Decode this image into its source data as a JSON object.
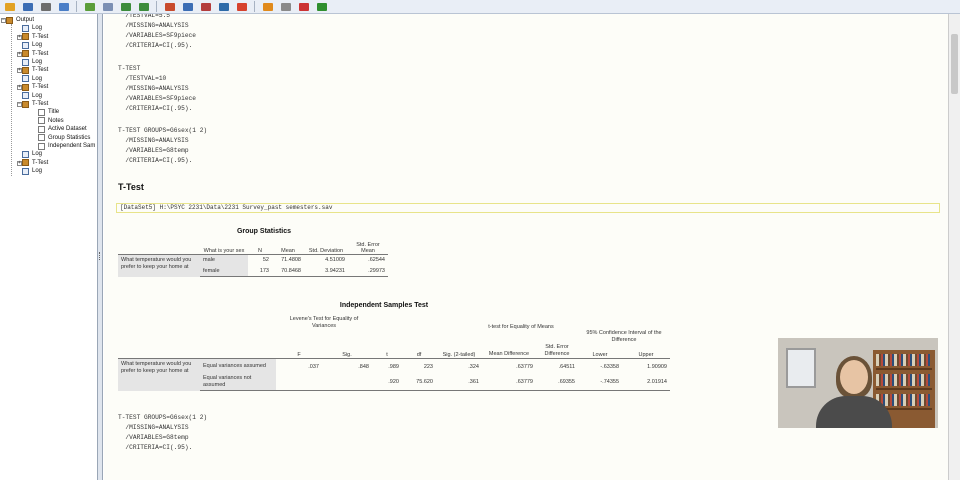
{
  "toolbar": {
    "buttons": [
      "open-icon",
      "save-icon",
      "print-icon",
      "print-preview-icon",
      "export-icon",
      "recall-dialog-icon",
      "undo-icon",
      "redo-icon",
      "goto-data-icon",
      "goto-case-icon",
      "variables-icon",
      "chart-icon",
      "insert-heading-icon",
      "insert-title-icon",
      "insert-text-icon",
      "designate-window-icon",
      "show-all-icon"
    ],
    "colors": [
      "#e2a224",
      "#3b6db4",
      "#6d6d6d",
      "#4a7ec7",
      "#5a9d3a",
      "#7b8fb3",
      "#3c8c3c",
      "#3c8c3c",
      "#c84b2d",
      "#3b6db4",
      "#b33c3c",
      "#2d6aa8",
      "#d6412d",
      "#e08a1c",
      "#8a8a8a",
      "#cc3333",
      "#2f8f2f"
    ]
  },
  "outline": {
    "items": [
      {
        "label": "Output",
        "level": 0,
        "icon": "output-book-icon"
      },
      {
        "label": "Log",
        "level": 1,
        "icon": "log-icon"
      },
      {
        "label": "T-Test",
        "level": 1,
        "icon": "book-icon"
      },
      {
        "label": "Log",
        "level": 1,
        "icon": "log-icon"
      },
      {
        "label": "T-Test",
        "level": 1,
        "icon": "book-icon"
      },
      {
        "label": "Log",
        "level": 1,
        "icon": "log-icon"
      },
      {
        "label": "T-Test",
        "level": 1,
        "icon": "book-icon"
      },
      {
        "label": "Log",
        "level": 1,
        "icon": "log-icon"
      },
      {
        "label": "T-Test",
        "level": 1,
        "icon": "book-icon"
      },
      {
        "label": "Log",
        "level": 1,
        "icon": "log-icon"
      },
      {
        "label": "T-Test",
        "level": 1,
        "icon": "book-icon"
      },
      {
        "label": "Title",
        "level": 2,
        "icon": "page-icon"
      },
      {
        "label": "Notes",
        "level": 2,
        "icon": "page-icon"
      },
      {
        "label": "Active Dataset",
        "level": 2,
        "icon": "page-icon"
      },
      {
        "label": "Group Statistics",
        "level": 2,
        "icon": "page-icon"
      },
      {
        "label": "Independent Sam",
        "level": 2,
        "icon": "page-icon"
      },
      {
        "label": "Log",
        "level": 1,
        "icon": "log-icon"
      },
      {
        "label": "T-Test",
        "level": 1,
        "icon": "book-icon"
      },
      {
        "label": "Log",
        "level": 1,
        "icon": "log-icon"
      }
    ]
  },
  "syntax": {
    "block1": "  /TESTVAL=5.5\n  /MISSING=ANALYSIS\n  /VARIABLES=SF9piece\n  /CRITERIA=CI(.95).",
    "block2": "T-TEST\n  /TESTVAL=10\n  /MISSING=ANALYSIS\n  /VARIABLES=SF9piece\n  /CRITERIA=CI(.95).",
    "block3": "T-TEST GROUPS=G6sex(1 2)\n  /MISSING=ANALYSIS\n  /VARIABLES=G8temp\n  /CRITERIA=CI(.95).",
    "block4": "T-TEST GROUPS=G6sex(1 2)\n  /MISSING=ANALYSIS\n  /VARIABLES=G8temp\n  /CRITERIA=CI(.95)."
  },
  "section_title": "T-Test",
  "dataset_line": "[DataSet5] H:\\PSYC 2231\\Data\\2231 Survey_past semesters.sav",
  "group_stats": {
    "title": "Group Statistics",
    "headers": [
      "What is your sex",
      "N",
      "Mean",
      "Std. Deviation",
      "Std. Error Mean"
    ],
    "row_label": "What temperature would you prefer to keep your home at",
    "rows": [
      {
        "group": "male",
        "n": "52",
        "mean": "71.4808",
        "sd": "4.51009",
        "se": ".62544"
      },
      {
        "group": "female",
        "n": "173",
        "mean": "70.8468",
        "sd": "3.94231",
        "se": ".29973"
      }
    ]
  },
  "ind_test": {
    "title": "Independent Samples Test",
    "levene_header": "Levene's Test for Equality of Variances",
    "ttest_header": "t-test for Equality of Means",
    "ci_header": "95% Confidence Interval of the Difference",
    "headers": [
      "F",
      "Sig.",
      "t",
      "df",
      "Sig. (2-tailed)",
      "Mean Difference",
      "Std. Error Difference",
      "Lower",
      "Upper"
    ],
    "row_label": "What temperature would you prefer to keep your home at",
    "rows": [
      {
        "label": "Equal variances assumed",
        "F": ".037",
        "sig": ".848",
        "t": ".989",
        "df": "223",
        "sig2": ".324",
        "md": ".63779",
        "sed": ".64511",
        "lower": "-.63358",
        "upper": "1.90909"
      },
      {
        "label": "Equal variances not assumed",
        "F": "",
        "sig": "",
        "t": ".920",
        "df": "75.620",
        "sig2": ".361",
        "md": ".63779",
        "sed": ".69355",
        "lower": "-.74355",
        "upper": "2.01914"
      }
    ]
  }
}
